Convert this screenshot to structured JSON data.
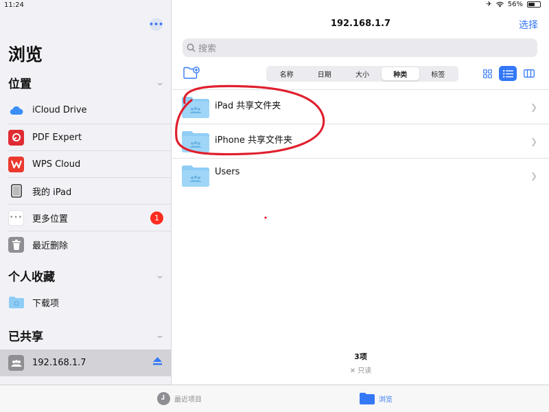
{
  "status_bar": {
    "time": "11:24",
    "battery_text": "56%",
    "battery_level": 0.56
  },
  "sidebar": {
    "title": "浏览",
    "sections": [
      {
        "title": "位置"
      },
      {
        "title": "个人收藏"
      },
      {
        "title": "已共享"
      }
    ],
    "locations": [
      {
        "label": "iCloud Drive",
        "icon": "icloud-icon"
      },
      {
        "label": "PDF Expert",
        "icon": "pdf-expert-icon"
      },
      {
        "label": "WPS Cloud",
        "icon": "wps-cloud-icon"
      },
      {
        "label": "我的 iPad",
        "icon": "ipad-icon"
      },
      {
        "label": "更多位置",
        "icon": "more-icon",
        "badge": "1"
      },
      {
        "label": "最近删除",
        "icon": "trash-icon"
      }
    ],
    "favorites": [
      {
        "label": "下载项",
        "icon": "download-folder-icon"
      }
    ],
    "shared": [
      {
        "label": "192.168.1.7",
        "icon": "shared-server-icon"
      }
    ]
  },
  "main": {
    "title": "192.168.1.7",
    "select_label": "选择",
    "search_placeholder": "搜索",
    "sort_options": [
      "名称",
      "日期",
      "大小",
      "种类",
      "标签"
    ],
    "selected_sort": "种类",
    "folders": [
      {
        "name": "iPad 共享文件夹"
      },
      {
        "name": "iPhone 共享文件夹"
      },
      {
        "name": "Users"
      }
    ],
    "footer_count": "3项",
    "footer_readonly": "只读"
  },
  "tabbar": {
    "tabs": [
      {
        "label": "最近项目",
        "icon": "clock-icon"
      },
      {
        "label": "浏览",
        "icon": "folder-icon",
        "active": true
      }
    ]
  },
  "colors": {
    "accent": "#3478f6",
    "badge": "#ff2d20",
    "annotation": "#e0202e",
    "folder": "#8fcdf5"
  }
}
